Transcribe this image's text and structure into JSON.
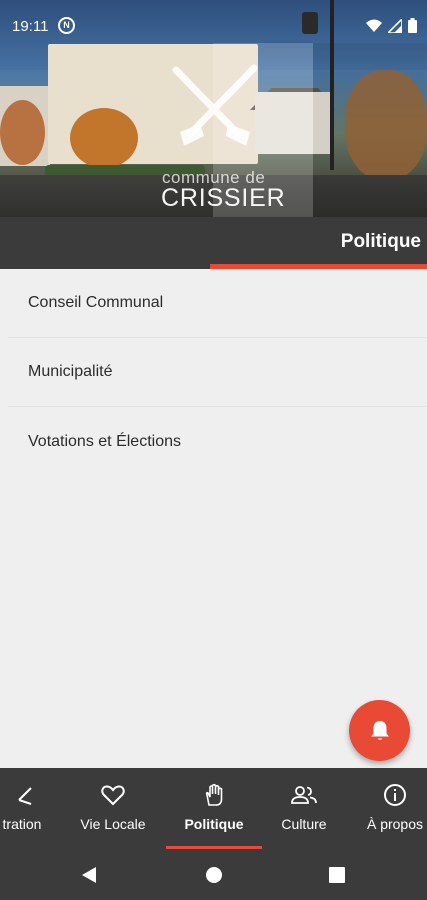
{
  "status_bar": {
    "time": "19:11",
    "nfc_label": "N"
  },
  "header": {
    "logo_line1": "commune de",
    "logo_line2": "CRISSIER",
    "section_title": "Politique"
  },
  "list": {
    "items": [
      {
        "label": "Conseil Communal"
      },
      {
        "label": "Municipalité"
      },
      {
        "label": "Votations et Élections"
      }
    ]
  },
  "fab": {
    "icon": "bell-icon"
  },
  "bottom_nav": {
    "items": [
      {
        "label": "tration",
        "icon": "admin-icon"
      },
      {
        "label": "Vie Locale",
        "icon": "heart-icon"
      },
      {
        "label": "Politique",
        "icon": "hand-icon",
        "active": true
      },
      {
        "label": "Culture",
        "icon": "people-icon"
      },
      {
        "label": "À propos",
        "icon": "info-icon"
      }
    ]
  },
  "colors": {
    "accent": "#e84a35",
    "bar": "#3b3b3b",
    "background": "#efefef"
  }
}
